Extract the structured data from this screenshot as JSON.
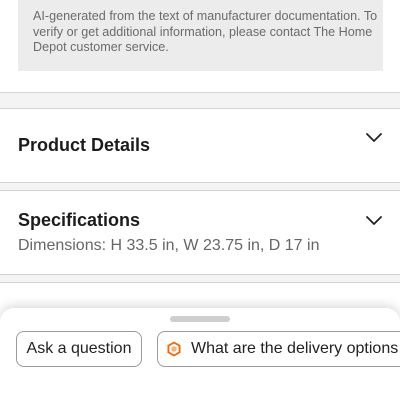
{
  "ai_disclaimer": {
    "text": "AI-generated from the text of manufacturer documentation. To verify or get additional information, please contact The Home Depot customer service."
  },
  "sections": {
    "product_details": {
      "title": "Product Details",
      "icon": "chevron-down-icon"
    },
    "specifications": {
      "title": "Specifications",
      "summary": "Dimensions: H 33.5 in, W 23.75 in, D 17 in",
      "icon": "chevron-down-icon"
    }
  },
  "bottom_sheet": {
    "chips": {
      "ask": "Ask a question",
      "delivery": "What are the delivery options"
    },
    "delivery_icon": "hexagon-icon"
  },
  "colors": {
    "accent_orange": "#f96302",
    "page_background": "#f4f4f4",
    "note_background": "#ececec"
  }
}
